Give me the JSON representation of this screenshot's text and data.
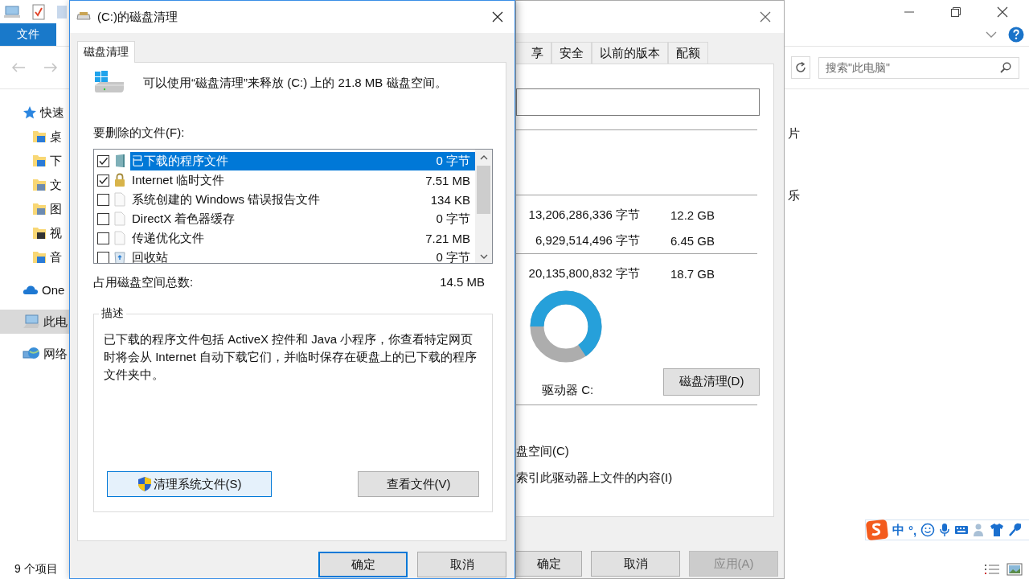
{
  "explorer": {
    "ribbon_tab": "文件",
    "search": {
      "placeholder": "搜索\"此电脑\""
    },
    "nav_items": [
      {
        "label": "快速",
        "kind": "star",
        "selected": false,
        "children": [
          {
            "label": "桌",
            "kind": "desktop",
            "selected": false
          },
          {
            "label": "下",
            "kind": "download",
            "selected": false
          },
          {
            "label": "文",
            "kind": "docs",
            "selected": false
          },
          {
            "label": "图",
            "kind": "pictures",
            "selected": false
          },
          {
            "label": "视",
            "kind": "video",
            "selected": false
          },
          {
            "label": "音",
            "kind": "music",
            "selected": false
          }
        ]
      },
      {
        "label": "One",
        "kind": "cloud",
        "selected": false
      },
      {
        "label": "此电",
        "kind": "pc",
        "selected": true
      },
      {
        "label": "网络",
        "kind": "network",
        "selected": false
      }
    ],
    "content_items": [
      "片",
      "乐"
    ],
    "status": "9 个项目"
  },
  "ime_bar": {
    "mode": "中",
    "punct": "°,"
  },
  "properties": {
    "tabs": [
      {
        "label": "享",
        "selected": false
      },
      {
        "label": "安全",
        "selected": false
      },
      {
        "label": "以前的版本",
        "selected": false
      },
      {
        "label": "配额",
        "selected": false
      }
    ],
    "rows": [
      {
        "bytes": "13,206,286,336 字节",
        "size": "12.2 GB"
      },
      {
        "bytes": "6,929,514,496 字节",
        "size": "6.45 GB"
      },
      {
        "bytes": "20,135,800,832 字节",
        "size": "18.7 GB"
      }
    ],
    "drive": {
      "label": "驱动器 C:"
    },
    "cleanup_button": "磁盘清理(D)",
    "options": [
      "盘空间(C)",
      "索引此驱动器上文件的内容(I)"
    ],
    "buttons": [
      {
        "label": "确定",
        "disabled": false
      },
      {
        "label": "取消",
        "disabled": false
      },
      {
        "label": "应用(A)",
        "disabled": true
      }
    ]
  },
  "cleanup": {
    "title": "(C:)的磁盘清理",
    "tabs": [
      {
        "label": "磁盘清理",
        "selected": true
      }
    ],
    "intro": "可以使用“磁盘清理”来释放  (C:) 上的 21.8 MB 磁盘空间。",
    "files_label": "要删除的文件(F):",
    "files": [
      {
        "name": "已下载的程序文件",
        "size": "0 字节",
        "checked": true,
        "selected": true,
        "kind": "program"
      },
      {
        "name": "Internet 临时文件",
        "size": "7.51 MB",
        "checked": true,
        "selected": false,
        "kind": "lock"
      },
      {
        "name": "系统创建的 Windows 错误报告文件",
        "size": "134 KB",
        "checked": false,
        "selected": false,
        "kind": "doc"
      },
      {
        "name": "DirectX 着色器缓存",
        "size": "0 字节",
        "checked": false,
        "selected": false,
        "kind": "doc"
      },
      {
        "name": "传递优化文件",
        "size": "7.21 MB",
        "checked": false,
        "selected": false,
        "kind": "doc"
      },
      {
        "name": "回收站",
        "size": "0 字节",
        "checked": false,
        "selected": false,
        "kind": "recycle"
      }
    ],
    "total_label": "占用磁盘空间总数:",
    "total": "14.5 MB",
    "description_label": "描述",
    "description": "已下载的程序文件包括 ActiveX 控件和 Java 小程序，你查看特定网页时将会从 Internet 自动下载它们，并临时保存在硬盘上的已下载的程序文件夹中。",
    "panel_buttons": [
      {
        "label": "清理系统文件(S)",
        "kind": "shield",
        "focused": true
      },
      {
        "label": "查看文件(V)",
        "kind": "plain",
        "focused": false
      }
    ],
    "footer_buttons": [
      {
        "label": "确定",
        "default": true
      },
      {
        "label": "取消",
        "default": false
      }
    ]
  }
}
